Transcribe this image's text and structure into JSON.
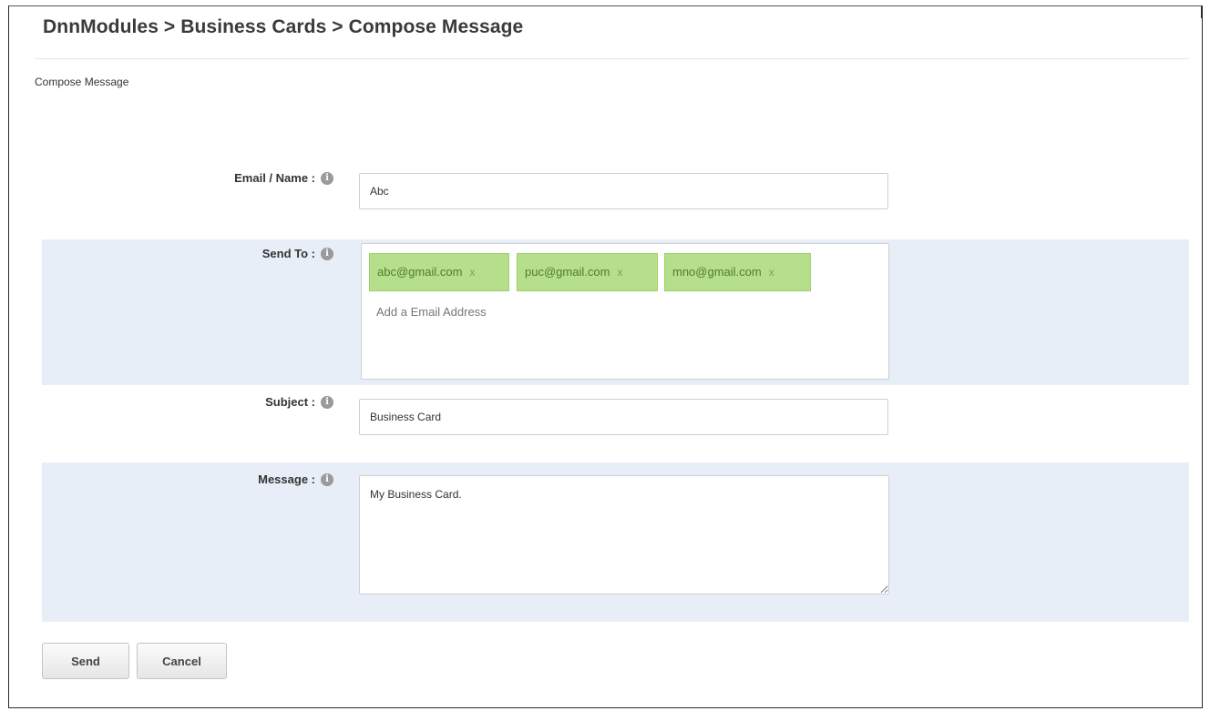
{
  "header": {
    "breadcrumb": "DnnModules > Business Cards > Compose Message"
  },
  "section": {
    "title": "Compose Message"
  },
  "form": {
    "email_name": {
      "label": "Email / Name :",
      "info_icon": "info-icon",
      "value": "Abc"
    },
    "send_to": {
      "label": "Send To :",
      "info_icon": "info-icon",
      "tags": [
        {
          "email": "abc@gmail.com",
          "remove": "x"
        },
        {
          "email": "puc@gmail.com",
          "remove": "x"
        },
        {
          "email": "mno@gmail.com",
          "remove": "x"
        }
      ],
      "placeholder": "Add a Email Address"
    },
    "subject": {
      "label": "Subject :",
      "info_icon": "info-icon",
      "value": "Business Card"
    },
    "message": {
      "label": "Message :",
      "info_icon": "info-icon",
      "value": "My Business Card."
    }
  },
  "buttons": {
    "send": "Send",
    "cancel": "Cancel"
  },
  "colors": {
    "band": "#e8eef8",
    "tag_bg": "#b5df8a",
    "tag_text": "#4f7d2a"
  }
}
